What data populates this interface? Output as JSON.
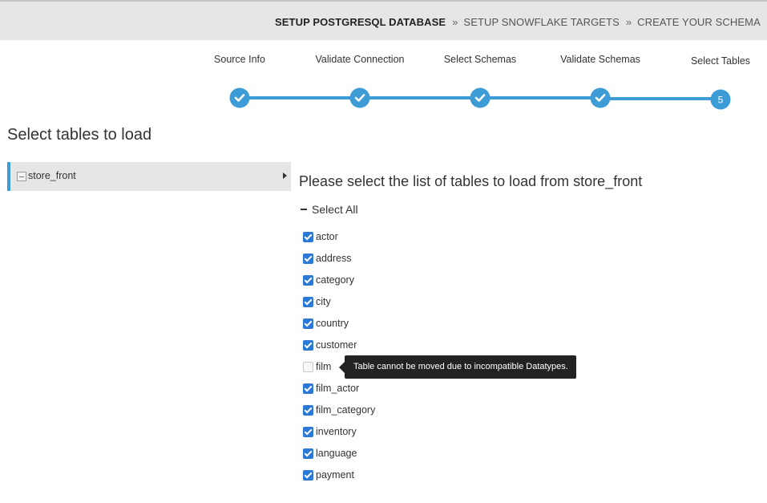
{
  "breadcrumb": {
    "steps": [
      "SETUP POSTGRESQL DATABASE",
      "SETUP SNOWFLAKE TARGETS",
      "CREATE YOUR SCHEMA"
    ],
    "separator": "»",
    "help_glyph": "?"
  },
  "wizard": {
    "steps": [
      {
        "label": "Source Info",
        "state": "done"
      },
      {
        "label": "Validate Connection",
        "state": "done"
      },
      {
        "label": "Select Schemas",
        "state": "done"
      },
      {
        "label": "Validate Schemas",
        "state": "done"
      },
      {
        "label": "Select Tables",
        "state": "current",
        "number": "5"
      }
    ],
    "accent_color": "#3d9bd6"
  },
  "page": {
    "title": "Select tables to load"
  },
  "schemas": [
    {
      "name": "store_front"
    }
  ],
  "panel": {
    "heading": "Please select the list of tables to load from store_front",
    "select_all_label": "Select All"
  },
  "tables": [
    {
      "name": "actor",
      "checked": true
    },
    {
      "name": "address",
      "checked": true
    },
    {
      "name": "category",
      "checked": true
    },
    {
      "name": "city",
      "checked": true
    },
    {
      "name": "country",
      "checked": true
    },
    {
      "name": "customer",
      "checked": true
    },
    {
      "name": "film",
      "checked": false
    },
    {
      "name": "film_actor",
      "checked": true
    },
    {
      "name": "film_category",
      "checked": true
    },
    {
      "name": "inventory",
      "checked": true
    },
    {
      "name": "language",
      "checked": true
    },
    {
      "name": "payment",
      "checked": true
    }
  ],
  "tooltip": {
    "text": "Table cannot be moved due to incompatible Datatypes."
  }
}
